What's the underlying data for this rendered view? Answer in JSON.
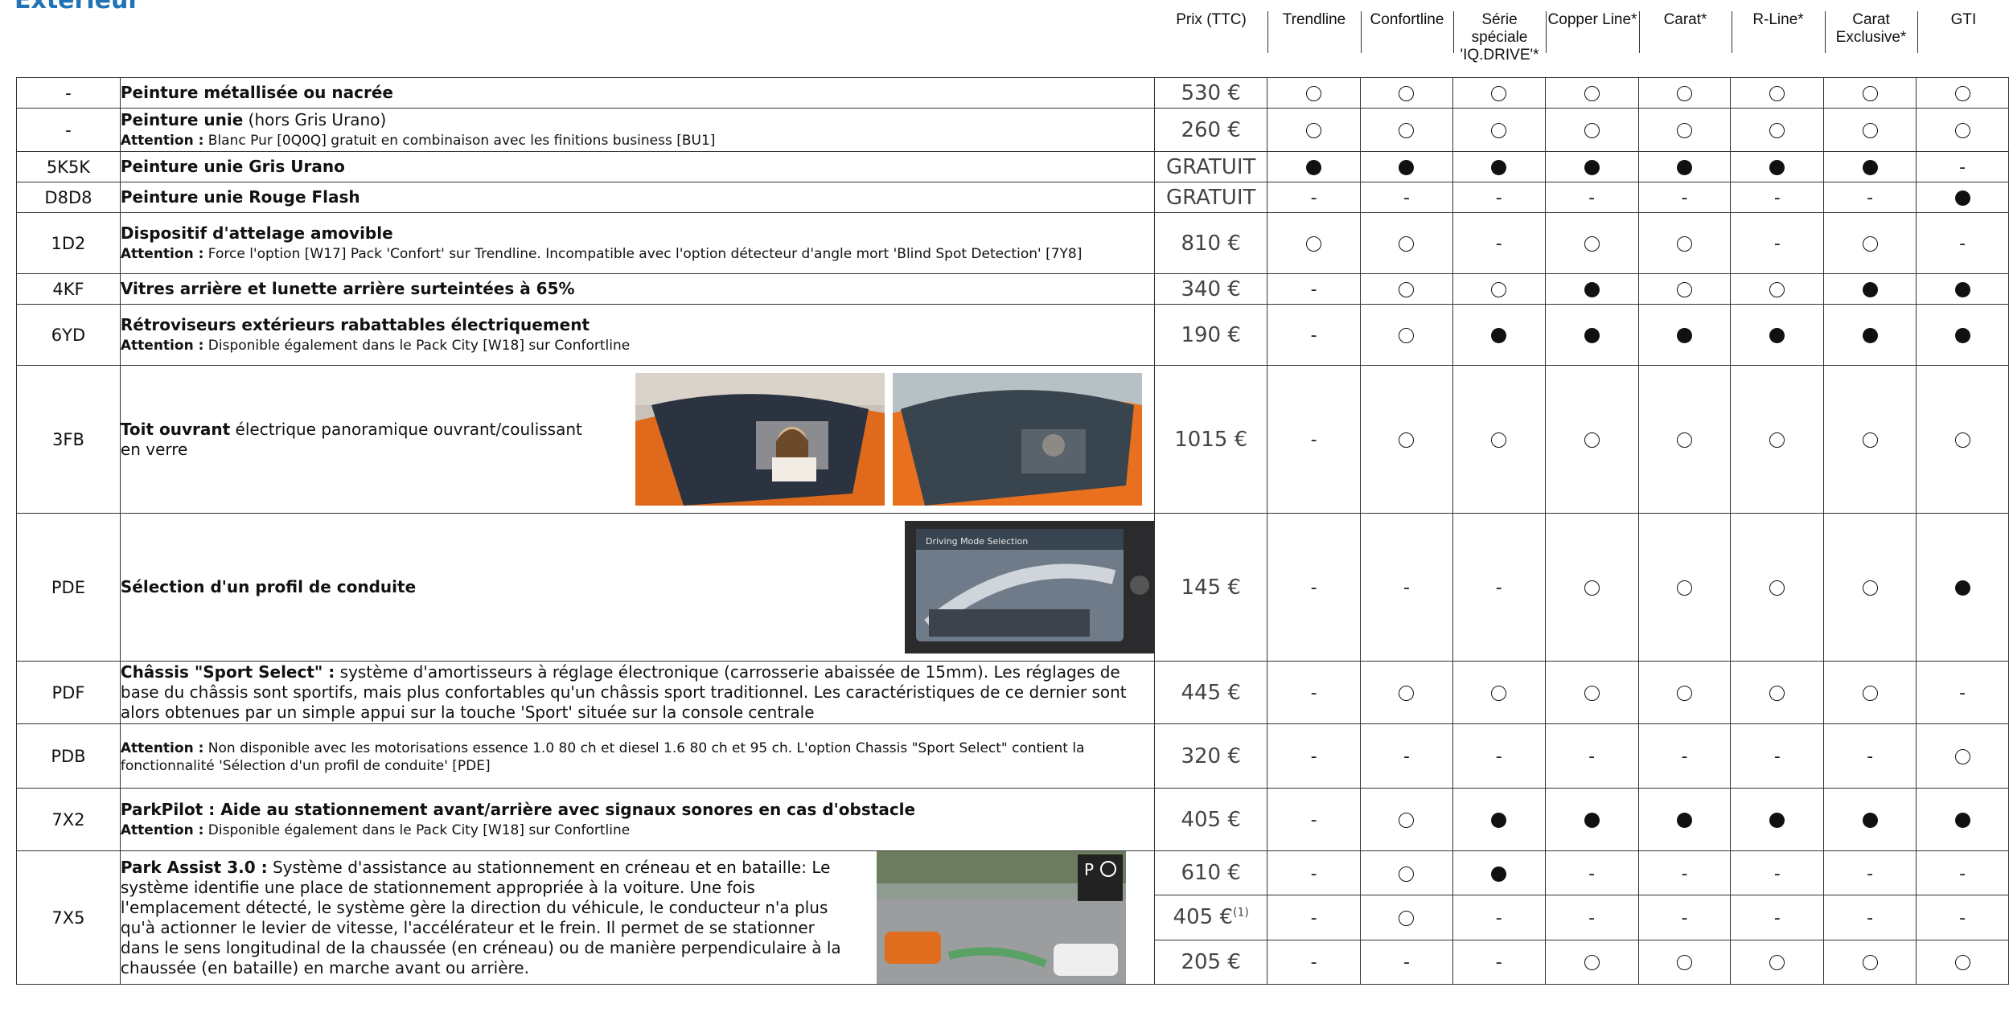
{
  "section_title": "Extérieur",
  "columns": [
    "Prix (TTC)",
    "Trendline",
    "Confortline",
    "Série spéciale 'IQ.DRIVE'*",
    "Copper Line*",
    "Carat*",
    "R-Line*",
    "Carat Exclusive*",
    "GTI"
  ],
  "columns_l1": [
    "Prix (TTC)",
    "Trendline",
    "Confortline",
    "Série spéciale",
    "Copper Line*",
    "Carat*",
    "R-Line*",
    "Carat",
    "GTI"
  ],
  "columns_l2": [
    "",
    "",
    "",
    "'IQ.DRIVE'*",
    "",
    "",
    "",
    "Exclusive*",
    ""
  ],
  "legend": {
    "standard": "●",
    "option": "○",
    "na": "-"
  },
  "rows": [
    {
      "code": "-",
      "title": "Peinture métallisée ou nacrée",
      "title_rest": "",
      "attention_label": "",
      "attention": "",
      "price": "530 €",
      "marks": [
        "o",
        "o",
        "o",
        "o",
        "o",
        "o",
        "o",
        "o"
      ]
    },
    {
      "code": "-",
      "title": "Peinture unie",
      "title_rest": " (hors Gris Urano)",
      "attention_label": "Attention :",
      "attention": " Blanc Pur [0Q0Q] gratuit en combinaison avec les finitions business [BU1]",
      "price": "260 €",
      "marks": [
        "o",
        "o",
        "o",
        "o",
        "o",
        "o",
        "o",
        "o"
      ]
    },
    {
      "code": "5K5K",
      "title": "Peinture unie Gris Urano",
      "title_rest": "",
      "attention_label": "",
      "attention": "",
      "price": "GRATUIT",
      "marks": [
        "s",
        "s",
        "s",
        "s",
        "s",
        "s",
        "s",
        "-"
      ]
    },
    {
      "code": "D8D8",
      "title": "Peinture unie Rouge Flash",
      "title_rest": "",
      "attention_label": "",
      "attention": "",
      "price": "GRATUIT",
      "marks": [
        "-",
        "-",
        "-",
        "-",
        "-",
        "-",
        "-",
        "s"
      ]
    },
    {
      "code": "1D2",
      "title": "Dispositif d'attelage amovible",
      "title_rest": "",
      "attention_label": "Attention :",
      "attention": " Force l'option [W17] Pack 'Confort' sur Trendline. Incompatible avec l'option détecteur d'angle mort 'Blind Spot Detection' [7Y8]",
      "price": "810 €",
      "marks": [
        "o",
        "o",
        "-",
        "o",
        "o",
        "-",
        "o",
        "-"
      ]
    },
    {
      "code": "4KF",
      "title": "Vitres arrière et lunette arrière surteintées à 65%",
      "title_rest": "",
      "attention_label": "",
      "attention": "",
      "price": "340 €",
      "marks": [
        "-",
        "o",
        "o",
        "s",
        "o",
        "o",
        "s",
        "s"
      ]
    },
    {
      "code": "6YD",
      "title": "Rétroviseurs extérieurs rabattables électriquement",
      "title_rest": "",
      "attention_label": "Attention :",
      "attention": " Disponible également dans le Pack City [W18] sur Confortline",
      "price": "190 €",
      "marks": [
        "-",
        "o",
        "s",
        "s",
        "s",
        "s",
        "s",
        "s"
      ]
    },
    {
      "code": "3FB",
      "title": "Toit ouvrant",
      "title_rest": " électrique panoramique ouvrant/coulissant en verre",
      "attention_label": "",
      "attention": "",
      "price": "1015 €",
      "marks": [
        "-",
        "o",
        "o",
        "o",
        "o",
        "o",
        "o",
        "o"
      ]
    },
    {
      "code": "PDE",
      "title": "Sélection d'un profil de conduite",
      "title_rest": "",
      "attention_label": "",
      "attention": "",
      "price": "145 €",
      "marks": [
        "-",
        "-",
        "-",
        "o",
        "o",
        "o",
        "o",
        "s"
      ]
    },
    {
      "code": "PDF",
      "title": "Châssis \"Sport Select\" :",
      "title_rest": " système d'amortisseurs à réglage électronique (carrosserie abaissée de 15mm). Les réglages de base du châssis sont sportifs, mais plus confortables qu'un châssis sport traditionnel. Les caractéristiques de ce dernier sont alors obtenues par un simple appui sur la touche 'Sport' située sur la console centrale",
      "attention_label": "",
      "attention": "",
      "price": "445 €",
      "marks": [
        "-",
        "o",
        "o",
        "o",
        "o",
        "o",
        "o",
        "-"
      ]
    },
    {
      "code": "PDB",
      "title": "",
      "title_rest": "",
      "attention_label": "Attention :",
      "attention": " Non disponible avec les motorisations essence 1.0 80 ch et diesel 1.6 80 ch et 95 ch. L'option Chassis \"Sport Select\" contient la fonctionnalité 'Sélection d'un profil de conduite' [PDE]",
      "price": "320 €",
      "marks": [
        "-",
        "-",
        "-",
        "-",
        "-",
        "-",
        "-",
        "o"
      ]
    },
    {
      "code": "7X2",
      "title": "ParkPilot : Aide au stationnement avant/arrière avec signaux sonores en cas d'obstacle",
      "title_rest": "",
      "attention_label": "Attention :",
      "attention": " Disponible également dans le Pack City [W18] sur Confortline",
      "price": "405 €",
      "marks": [
        "-",
        "o",
        "s",
        "s",
        "s",
        "s",
        "s",
        "s"
      ]
    },
    {
      "code": "7X5",
      "title": "Park Assist 3.0 :",
      "title_rest": " Système d'assistance au stationnement en créneau et en bataille: Le système identifie une place de stationnement appropriée à la voiture. Une fois l'emplacement détecté, le système gère la direction du véhicule, le conducteur n'a plus qu'à actionner le levier de vitesse, l'accélérateur et le frein. Il permet de se stationner dans le sens longitudinal de la chaussée (en créneau) ou de manière perpendiculaire à la chaussée (en bataille) en marche avant ou arrière.",
      "attention_label": "",
      "attention": "",
      "price": "610 €",
      "marks": [
        "-",
        "o",
        "s",
        "-",
        "-",
        "-",
        "-",
        "-"
      ]
    },
    {
      "code": "",
      "title": "",
      "title_rest": "",
      "attention_label": "",
      "attention": "",
      "price": "405 €",
      "price_sup": "(1)",
      "marks": [
        "-",
        "o",
        "-",
        "-",
        "-",
        "-",
        "-",
        "-"
      ]
    },
    {
      "code": "",
      "title": "",
      "title_rest": "",
      "attention_label": "",
      "attention": "",
      "price": "205 €",
      "marks": [
        "-",
        "-",
        "-",
        "o",
        "o",
        "o",
        "o",
        "o"
      ]
    }
  ]
}
